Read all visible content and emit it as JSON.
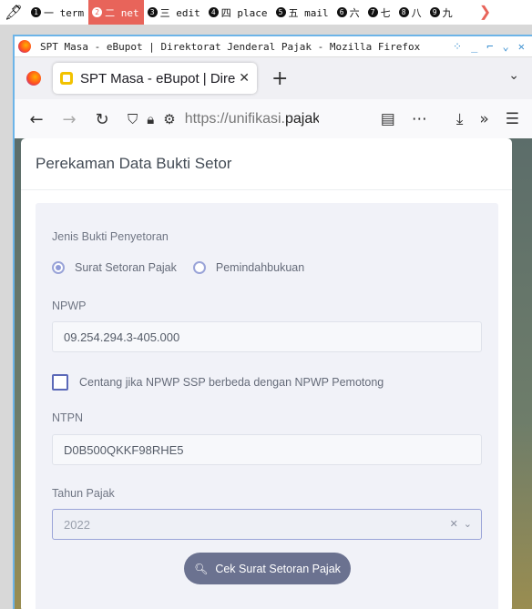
{
  "wm": {
    "workspaces": [
      {
        "num": "1",
        "label": "一 term",
        "active": false
      },
      {
        "num": "2",
        "label": "二 net",
        "active": true
      },
      {
        "num": "3",
        "label": "三 edit",
        "active": false
      },
      {
        "num": "4",
        "label": "四 place",
        "active": false
      },
      {
        "num": "5",
        "label": "五 mail",
        "active": false
      },
      {
        "num": "6",
        "label": "六",
        "active": false
      },
      {
        "num": "7",
        "label": "七",
        "active": false
      },
      {
        "num": "8",
        "label": "八",
        "active": false
      },
      {
        "num": "9",
        "label": "九",
        "active": false
      }
    ]
  },
  "window": {
    "title": "SPT Masa - eBupot | Direktorat Jenderal Pajak - Mozilla Firefox"
  },
  "browser": {
    "tab_title": "SPT Masa - eBupot | Direktorat",
    "url_prefix": "https://unifikasi.",
    "url_domain": "pajak.g"
  },
  "page": {
    "card_title": "Perekaman Data Bukti Setor",
    "jenis_label": "Jenis Bukti Penyetoran",
    "radio_options": [
      {
        "label": "Surat Setoran Pajak",
        "selected": true
      },
      {
        "label": "Pemindahbukuan",
        "selected": false
      }
    ],
    "npwp_label": "NPWP",
    "npwp_value": "09.254.294.3-405.000",
    "checkbox_label": "Centang jika NPWP SSP berbeda dengan NPWP Pemotong",
    "ntpn_label": "NTPN",
    "ntpn_value": "D0B500QKKF98RHE5",
    "tahun_label": "Tahun Pajak",
    "tahun_value": "2022",
    "cek_button": "Cek Surat Setoran Pajak"
  }
}
